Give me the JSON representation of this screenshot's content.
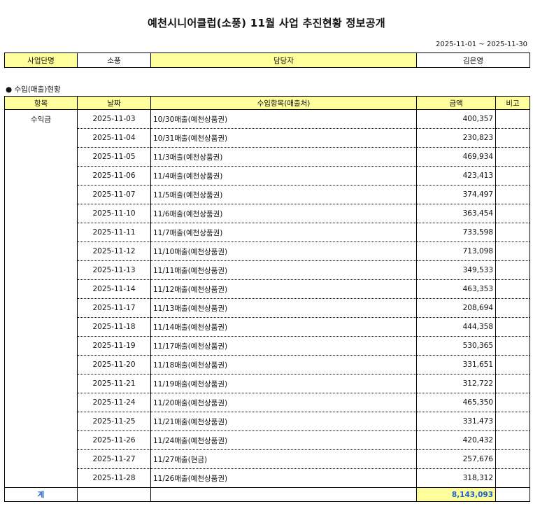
{
  "title": "예천시니어클럽(소풍) 11월 사업 추진현황 정보공개",
  "period": "2025-11-01 ~ 2025-11-30",
  "info": {
    "biz_label": "사업단명",
    "biz_value": "소풍",
    "manager_label": "담당자",
    "manager_value": "김은영"
  },
  "section_title": "● 수입(매출)현황",
  "table": {
    "headers": [
      "항목",
      "날짜",
      "수입항목(매출처)",
      "금액",
      "비고"
    ],
    "category": "수익금",
    "rows": [
      {
        "date": "2025-11-03",
        "item": "10/30매출(예천상품권)",
        "amount": "400,357",
        "note": ""
      },
      {
        "date": "2025-11-04",
        "item": "10/31매출(예천상품권)",
        "amount": "230,823",
        "note": ""
      },
      {
        "date": "2025-11-05",
        "item": "11/3매출(예천상품권)",
        "amount": "469,934",
        "note": ""
      },
      {
        "date": "2025-11-06",
        "item": "11/4매출(예천상품권)",
        "amount": "423,413",
        "note": ""
      },
      {
        "date": "2025-11-07",
        "item": "11/5매출(예천상품권)",
        "amount": "374,497",
        "note": ""
      },
      {
        "date": "2025-11-10",
        "item": "11/6매출(예천상품권)",
        "amount": "363,454",
        "note": ""
      },
      {
        "date": "2025-11-11",
        "item": "11/7매출(예천상품권)",
        "amount": "733,598",
        "note": ""
      },
      {
        "date": "2025-11-12",
        "item": "11/10매출(예천상품권)",
        "amount": "713,098",
        "note": ""
      },
      {
        "date": "2025-11-13",
        "item": "11/11매출(예천상품권)",
        "amount": "349,533",
        "note": ""
      },
      {
        "date": "2025-11-14",
        "item": "11/12매출(예천상품권)",
        "amount": "463,353",
        "note": ""
      },
      {
        "date": "2025-11-17",
        "item": "11/13매출(예천상품권)",
        "amount": "208,694",
        "note": ""
      },
      {
        "date": "2025-11-18",
        "item": "11/14매출(예천상품권)",
        "amount": "444,358",
        "note": ""
      },
      {
        "date": "2025-11-19",
        "item": "11/17매출(예천상품권)",
        "amount": "530,365",
        "note": ""
      },
      {
        "date": "2025-11-20",
        "item": "11/18매출(예천상품권)",
        "amount": "331,651",
        "note": ""
      },
      {
        "date": "2025-11-21",
        "item": "11/19매출(예천상품권)",
        "amount": "312,722",
        "note": ""
      },
      {
        "date": "2025-11-24",
        "item": "11/20매출(예천상품권)",
        "amount": "465,350",
        "note": ""
      },
      {
        "date": "2025-11-25",
        "item": "11/21매출(예천상품권)",
        "amount": "331,473",
        "note": ""
      },
      {
        "date": "2025-11-26",
        "item": "11/24매출(예천상품권)",
        "amount": "420,432",
        "note": ""
      },
      {
        "date": "2025-11-27",
        "item": "11/27매출(현금)",
        "amount": "257,676",
        "note": ""
      },
      {
        "date": "2025-11-28",
        "item": "11/26매출(예천상품권)",
        "amount": "318,312",
        "note": ""
      }
    ],
    "total_label": "계",
    "total_amount": "8,143,093"
  },
  "colors": {
    "header_fill": "#fefe9c",
    "total_label": "#1a63c9"
  }
}
